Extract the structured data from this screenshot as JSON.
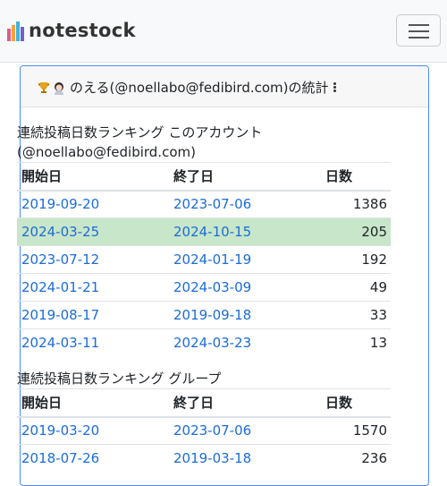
{
  "brand": {
    "name": "notestock"
  },
  "card": {
    "title": "のえる(@noellabo@fedibird.com)の統計",
    "account_section": {
      "title": "連続投稿日数ランキング このアカウント (@noellabo@fedibird.com)",
      "headers": [
        "開始日",
        "終了日",
        "日数"
      ],
      "rows": [
        {
          "start": "2019-09-20",
          "end": "2023-07-06",
          "days": "1386",
          "highlight": false
        },
        {
          "start": "2024-03-25",
          "end": "2024-10-15",
          "days": "205",
          "highlight": true
        },
        {
          "start": "2023-07-12",
          "end": "2024-01-19",
          "days": "192",
          "highlight": false
        },
        {
          "start": "2024-01-21",
          "end": "2024-03-09",
          "days": "49",
          "highlight": false
        },
        {
          "start": "2019-08-17",
          "end": "2019-09-18",
          "days": "33",
          "highlight": false
        },
        {
          "start": "2024-03-11",
          "end": "2024-03-23",
          "days": "13",
          "highlight": false
        }
      ]
    },
    "group_section": {
      "title": "連続投稿日数ランキング グループ",
      "headers": [
        "開始日",
        "終了日",
        "日数"
      ],
      "rows": [
        {
          "start": "2019-03-20",
          "end": "2023-07-06",
          "days": "1570"
        },
        {
          "start": "2018-07-26",
          "end": "2019-03-18",
          "days": "236"
        }
      ]
    }
  },
  "colors": {
    "link": "#1b6cd8",
    "highlight": "#c8e6c9",
    "card_border": "#4b8bf5"
  },
  "icons": {
    "trophy": "trophy-icon",
    "avatar": "avatar-icon",
    "menu": "hamburger-menu-icon",
    "more": "kebab-menu-icon"
  }
}
